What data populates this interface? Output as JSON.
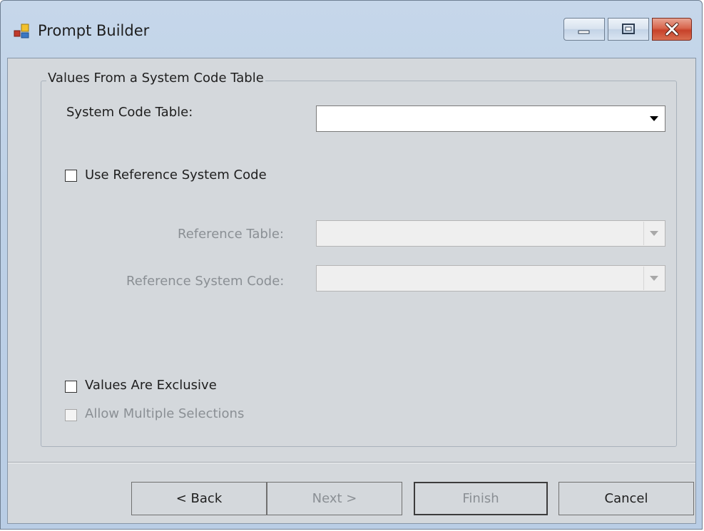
{
  "window": {
    "title": "Prompt Builder",
    "icon": "app-window-icon",
    "controls": [
      "minimize-icon",
      "maximize-icon",
      "close-icon"
    ]
  },
  "groupbox": {
    "title": "Values From a System Code Table"
  },
  "fields": {
    "system_code_table": {
      "label": "System Code Table:",
      "value": ""
    },
    "use_reference": {
      "label": "Use Reference System Code",
      "checked": false
    },
    "reference_table": {
      "label": "Reference Table:",
      "value": "",
      "enabled": false
    },
    "reference_system_code": {
      "label": "Reference System Code:",
      "value": "",
      "enabled": false
    },
    "values_exclusive": {
      "label": "Values Are Exclusive",
      "checked": false
    },
    "allow_multiple": {
      "label": "Allow Multiple Selections",
      "checked": false,
      "enabled": false
    }
  },
  "buttons": {
    "back": "< Back",
    "next": "Next >",
    "finish": "Finish",
    "cancel": "Cancel"
  }
}
